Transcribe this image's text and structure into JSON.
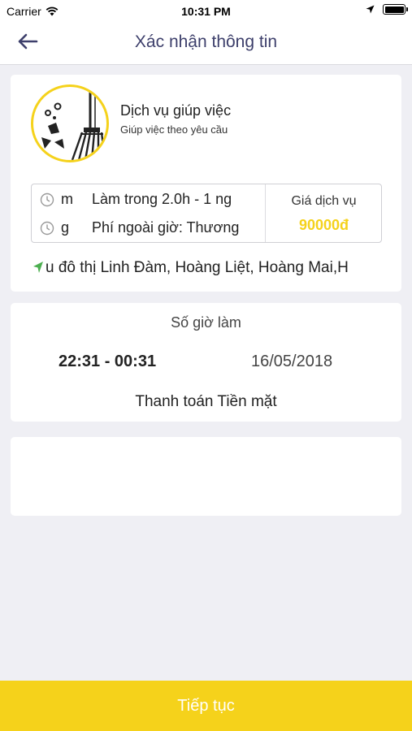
{
  "status_bar": {
    "carrier": "Carrier",
    "time": "10:31 PM",
    "icons": [
      "wifi-icon",
      "location-arrow-icon",
      "battery-icon"
    ]
  },
  "nav": {
    "title": "Xác nhận thông tin",
    "back_icon": "back-arrow-icon"
  },
  "service": {
    "icon": "broom-icon",
    "name": "Dịch vụ giúp việc",
    "description": "Giúp việc theo yêu cầu",
    "rows": [
      {
        "icon": "clock-icon",
        "code": "m",
        "text": "Làm trong 2.0h - 1 ng"
      },
      {
        "icon": "clock-icon",
        "code": "g",
        "text": "Phí ngoài giờ: Thương"
      }
    ],
    "price_label": "Giá dịch vụ",
    "price_value": "90000đ",
    "address_icon": "location-arrow-icon",
    "address": "u đô thị Linh Đàm, Hoàng Liệt, Hoàng Mai,H"
  },
  "schedule": {
    "label": "Số giờ làm",
    "time_range": "22:31 - 00:31",
    "date": "16/05/2018",
    "payment": "Thanh toán Tiền mặt"
  },
  "cta": {
    "label": "Tiếp tục"
  },
  "colors": {
    "accent": "#f5d21b",
    "title": "#3d3f6b",
    "background": "#efeff4"
  }
}
